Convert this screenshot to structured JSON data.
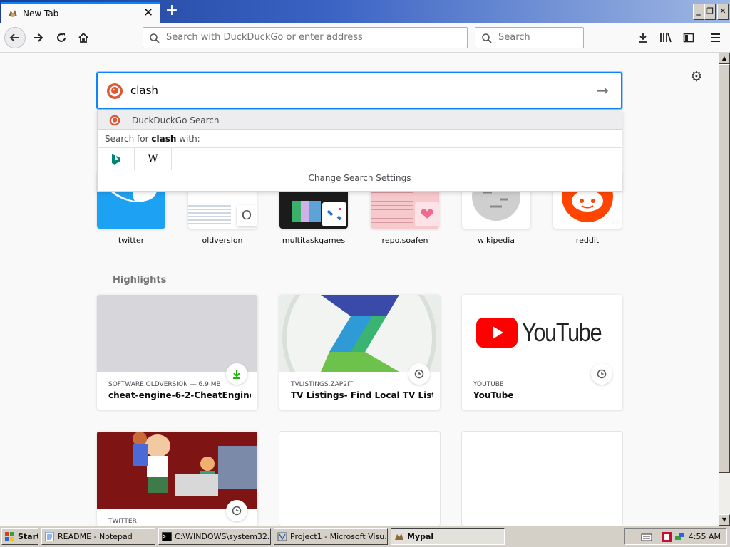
{
  "browser": {
    "tab_title": "New Tab",
    "url_placeholder": "Search with DuckDuckGo or enter address",
    "search_placeholder": "Search"
  },
  "search": {
    "query": "clash",
    "engine_label": "DuckDuckGo Search",
    "search_for_prefix": "Search for",
    "search_for_term": "clash",
    "search_for_suffix": "with:",
    "change_settings": "Change Search Settings"
  },
  "top_sites": [
    {
      "label": "twitter"
    },
    {
      "label": "oldversion"
    },
    {
      "label": "multitaskgames"
    },
    {
      "label": "repo.soafen"
    },
    {
      "label": "wikipedia"
    },
    {
      "label": "reddit"
    }
  ],
  "highlights": {
    "title": "Highlights",
    "cards": [
      {
        "source": "SOFTWARE.OLDVERSION — 6.9 MB",
        "title": "cheat-engine-6-2-CheatEngine6...",
        "badge_icon": "download-icon"
      },
      {
        "source": "TVLISTINGS.ZAP2IT",
        "title": "TV Listings- Find Local TV Listing...",
        "badge_icon": "clock-icon"
      },
      {
        "source": "YOUTUBE",
        "title": "YouTube",
        "badge_icon": "clock-icon"
      },
      {
        "source": "TWITTER",
        "title": "",
        "badge_icon": "clock-icon"
      }
    ],
    "youtube_logo_text": "YouTube"
  },
  "taskbar": {
    "start_label": "Start",
    "items": [
      {
        "label": "README - Notepad"
      },
      {
        "label": "C:\\WINDOWS\\system32..."
      },
      {
        "label": "Project1 - Microsoft Visu..."
      },
      {
        "label": "Mypal"
      }
    ],
    "clock": "4:55 AM"
  },
  "colors": {
    "accent": "#0a84ff",
    "titlebar": "#1c3f94",
    "youtube_red": "#ff0000",
    "twitter_blue": "#1da1f2",
    "reddit_orange": "#ff4500"
  }
}
